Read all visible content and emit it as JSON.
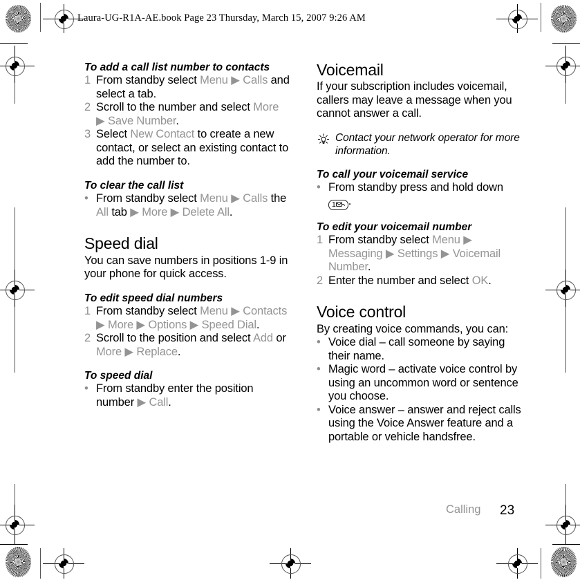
{
  "header": {
    "file_line": "Laura-UG-R1A-AE.book  Page 23  Thursday, March 15, 2007  9:26 AM"
  },
  "footer": {
    "chapter": "Calling",
    "page_number": "23"
  },
  "colors": {
    "ui_reference_gray": "#949494",
    "step_number_gray": "#8f8f8f",
    "body_black": "#000000",
    "footer_chapter_gray": "#939393"
  },
  "left_column": {
    "blocks": [
      {
        "type": "procedure-heading",
        "text": "To add a call list number to contacts"
      },
      {
        "type": "numbered-step",
        "number": "1",
        "runs": [
          {
            "t": "From standby select ",
            "style": "body"
          },
          {
            "t": "Menu",
            "style": "ui"
          },
          {
            "t": " ▶ ",
            "style": "arrow"
          },
          {
            "t": "Calls",
            "style": "ui"
          },
          {
            "t": " and select a tab.",
            "style": "body"
          }
        ]
      },
      {
        "type": "numbered-step",
        "number": "2",
        "runs": [
          {
            "t": "Scroll to the number and select ",
            "style": "body"
          },
          {
            "t": "More",
            "style": "ui"
          },
          {
            "t": " ▶ ",
            "style": "arrow"
          },
          {
            "t": "Save Number",
            "style": "ui"
          },
          {
            "t": ".",
            "style": "body"
          }
        ]
      },
      {
        "type": "numbered-step",
        "number": "3",
        "runs": [
          {
            "t": "Select ",
            "style": "body"
          },
          {
            "t": "New Contact",
            "style": "ui"
          },
          {
            "t": " to create a new contact, or select an existing contact to add the number to.",
            "style": "body"
          }
        ]
      },
      {
        "type": "procedure-heading",
        "text": "To clear the call list"
      },
      {
        "type": "bullet-step",
        "bullet": "•",
        "runs": [
          {
            "t": "From standby select ",
            "style": "body"
          },
          {
            "t": "Menu",
            "style": "ui"
          },
          {
            "t": " ▶ ",
            "style": "arrow"
          },
          {
            "t": "Calls",
            "style": "ui"
          },
          {
            "t": " the ",
            "style": "body"
          },
          {
            "t": "All",
            "style": "ui"
          },
          {
            "t": " tab ",
            "style": "body"
          },
          {
            "t": "▶ ",
            "style": "arrow"
          },
          {
            "t": "More",
            "style": "ui"
          },
          {
            "t": " ▶ ",
            "style": "arrow"
          },
          {
            "t": "Delete All",
            "style": "ui"
          },
          {
            "t": ".",
            "style": "body"
          }
        ]
      },
      {
        "type": "section-heading",
        "text": "Speed dial"
      },
      {
        "type": "paragraph",
        "text": "You can save numbers in positions 1-9 in your phone for quick access."
      },
      {
        "type": "procedure-heading",
        "text": "To edit speed dial numbers"
      },
      {
        "type": "numbered-step",
        "number": "1",
        "runs": [
          {
            "t": "From standby select ",
            "style": "body"
          },
          {
            "t": "Menu",
            "style": "ui"
          },
          {
            "t": " ▶ ",
            "style": "arrow"
          },
          {
            "t": "Contacts",
            "style": "ui"
          },
          {
            "t": " ▶ ",
            "style": "arrow"
          },
          {
            "t": "More",
            "style": "ui"
          },
          {
            "t": " ▶ ",
            "style": "arrow"
          },
          {
            "t": "Options",
            "style": "ui"
          },
          {
            "t": " ▶ ",
            "style": "arrow"
          },
          {
            "t": "Speed Dial",
            "style": "ui"
          },
          {
            "t": ".",
            "style": "body"
          }
        ]
      },
      {
        "type": "numbered-step",
        "number": "2",
        "runs": [
          {
            "t": "Scroll to the position and select ",
            "style": "body"
          },
          {
            "t": "Add",
            "style": "ui"
          },
          {
            "t": " or ",
            "style": "body"
          },
          {
            "t": "More",
            "style": "ui"
          },
          {
            "t": " ▶ ",
            "style": "arrow"
          },
          {
            "t": "Replace",
            "style": "ui"
          },
          {
            "t": ".",
            "style": "body"
          }
        ]
      },
      {
        "type": "procedure-heading",
        "text": "To speed dial"
      },
      {
        "type": "bullet-step",
        "bullet": "•",
        "runs": [
          {
            "t": "From standby enter the position number ",
            "style": "body"
          },
          {
            "t": "▶ ",
            "style": "arrow"
          },
          {
            "t": "Call",
            "style": "ui"
          },
          {
            "t": ".",
            "style": "body"
          }
        ]
      }
    ]
  },
  "right_column": {
    "blocks": [
      {
        "type": "section-heading",
        "text": "Voicemail"
      },
      {
        "type": "paragraph",
        "text": "If your subscription includes voicemail, callers may leave a message when you cannot answer a call."
      },
      {
        "type": "tip",
        "icon": "lightbulb-icon",
        "text": "Contact your network operator for more information."
      },
      {
        "type": "procedure-heading",
        "text": "To call your voicemail service"
      },
      {
        "type": "bullet-step-keycap",
        "bullet": "•",
        "text_before": "From standby press and hold down ",
        "keycap": {
          "digit": "1",
          "icon": "envelope-icon"
        },
        "text_after": "."
      },
      {
        "type": "procedure-heading",
        "text": "To edit your voicemail number"
      },
      {
        "type": "numbered-step",
        "number": "1",
        "runs": [
          {
            "t": "From standby select ",
            "style": "body"
          },
          {
            "t": "Menu",
            "style": "ui"
          },
          {
            "t": " ▶ ",
            "style": "arrow"
          },
          {
            "t": "Messaging",
            "style": "ui"
          },
          {
            "t": " ▶ ",
            "style": "arrow"
          },
          {
            "t": "Settings",
            "style": "ui"
          },
          {
            "t": " ▶ ",
            "style": "arrow"
          },
          {
            "t": "Voicemail Number",
            "style": "ui"
          },
          {
            "t": ".",
            "style": "body"
          }
        ]
      },
      {
        "type": "numbered-step",
        "number": "2",
        "runs": [
          {
            "t": "Enter the number and select ",
            "style": "body"
          },
          {
            "t": "OK",
            "style": "ui"
          },
          {
            "t": ".",
            "style": "body"
          }
        ]
      },
      {
        "type": "section-heading",
        "text": "Voice control"
      },
      {
        "type": "paragraph",
        "text": "By creating voice commands, you can:"
      },
      {
        "type": "bullet-step",
        "bullet": "•",
        "runs": [
          {
            "t": "Voice dial – call someone by saying their name.",
            "style": "body"
          }
        ]
      },
      {
        "type": "bullet-step",
        "bullet": "•",
        "runs": [
          {
            "t": "Magic word – activate voice control by using an uncommon word or sentence you choose.",
            "style": "body"
          }
        ]
      },
      {
        "type": "bullet-step",
        "bullet": "•",
        "runs": [
          {
            "t": "Voice answer – answer and reject calls using the Voice Answer feature and a portable or vehicle handsfree.",
            "style": "body"
          }
        ]
      }
    ]
  }
}
